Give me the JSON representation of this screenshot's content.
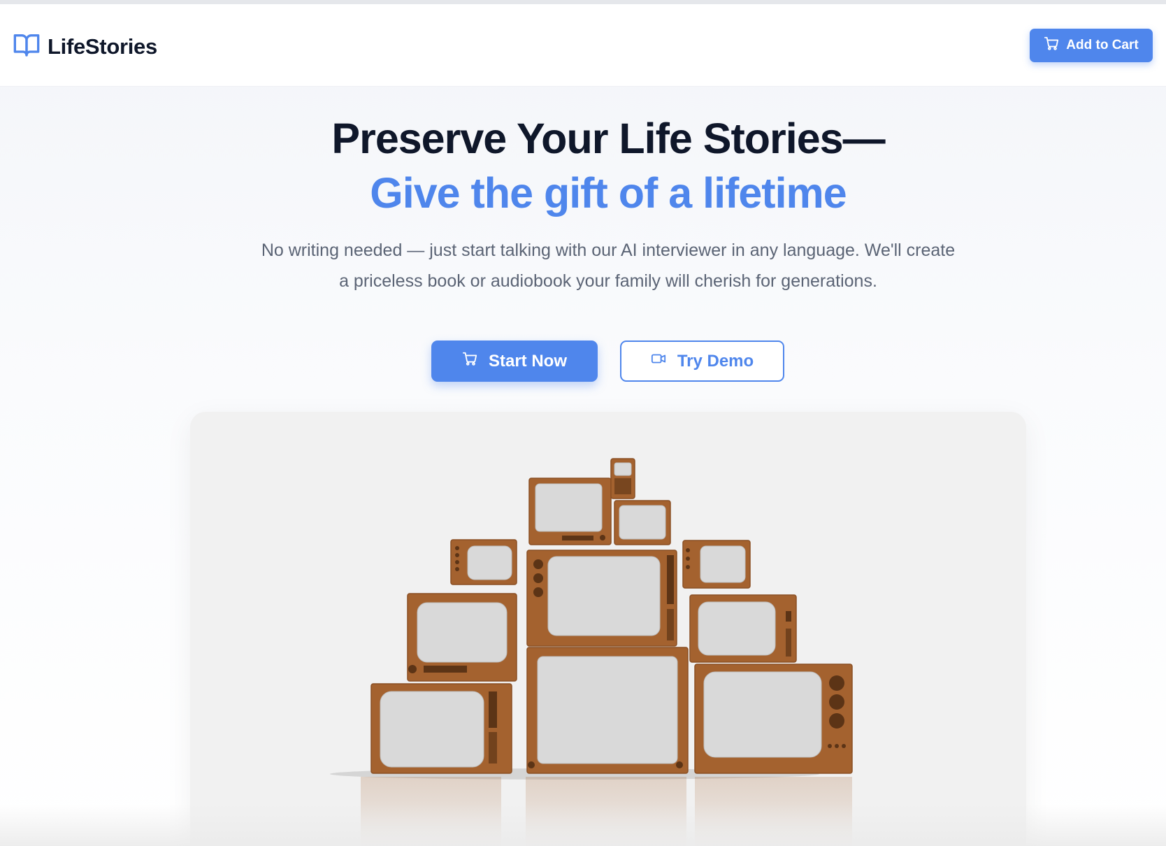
{
  "brand": {
    "name": "LifeStories",
    "icon": "open-book-icon",
    "accent": "#4f86ec"
  },
  "header": {
    "cart_button": {
      "label": "Add to Cart",
      "icon": "cart-icon"
    }
  },
  "hero": {
    "headline": "Preserve Your Life Stories—",
    "subheadline": "Give the gift of a lifetime",
    "description": "No writing needed — just start talking with our AI interviewer in any language. We'll create a priceless book or audiobook your family will cherish for generations.",
    "primary_cta": {
      "label": "Start Now",
      "icon": "cart-icon"
    },
    "secondary_cta": {
      "label": "Try Demo",
      "icon": "video-camera-icon"
    },
    "image": {
      "subject": "stack of vintage television sets"
    }
  },
  "colors": {
    "accent": "#4f86ec",
    "heading": "#0f172a",
    "body": "#5b6475",
    "tv_wood": "#a4622f"
  }
}
